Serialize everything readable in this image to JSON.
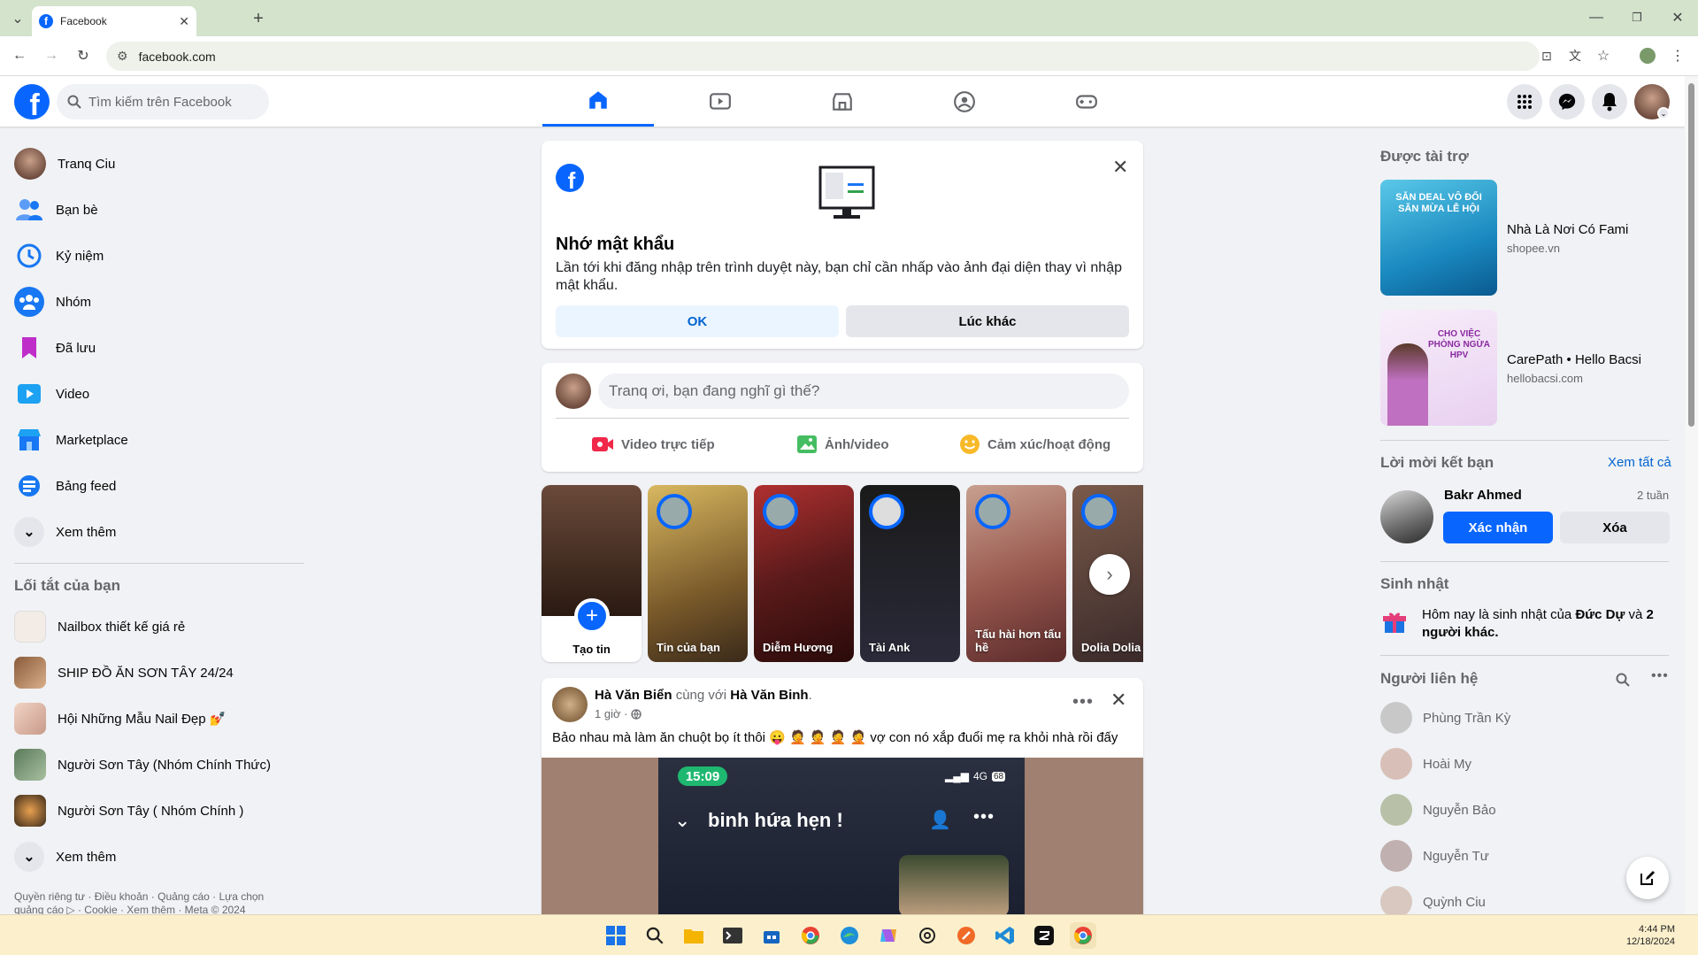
{
  "browser": {
    "tab_title": "Facebook",
    "url": "facebook.com"
  },
  "fb_nav": {
    "search_placeholder": "Tìm kiếm trên Facebook"
  },
  "left_sidebar": {
    "profile_name": "Tranq Ciu",
    "items": [
      {
        "label": "Bạn bè",
        "icon": "friends-icon"
      },
      {
        "label": "Kỷ niệm",
        "icon": "memories-icon"
      },
      {
        "label": "Nhóm",
        "icon": "groups-icon"
      },
      {
        "label": "Đã lưu",
        "icon": "saved-icon"
      },
      {
        "label": "Video",
        "icon": "video-icon"
      },
      {
        "label": "Marketplace",
        "icon": "marketplace-icon"
      },
      {
        "label": "Bảng feed",
        "icon": "feeds-icon"
      },
      {
        "label": "Xem thêm",
        "icon": "chevron-down-icon"
      }
    ],
    "shortcuts_title": "Lối tắt của bạn",
    "shortcuts": [
      {
        "label": "Nailbox thiết kế giá rẻ"
      },
      {
        "label": "SHIP ĐỒ ĂN SƠN TÂY 24/24"
      },
      {
        "label": "Hội Những Mẫu Nail Đẹp 💅"
      },
      {
        "label": "Người Sơn Tây (Nhóm Chính Thức)"
      },
      {
        "label": "Người Sơn Tây ( Nhóm Chính )"
      }
    ],
    "shortcuts_more": "Xem thêm",
    "footer_line1": "Quyền riêng tư · Điều khoản · Quảng cáo · Lựa chọn",
    "footer_line2": "quảng cáo ▷ · Cookie · Xem thêm · Meta © 2024"
  },
  "remember_password": {
    "title": "Nhớ mật khẩu",
    "body": "Lần tới khi đăng nhập trên trình duyệt này, bạn chỉ cần nhấp vào ảnh đại diện thay vì nhập mật khẩu.",
    "ok_label": "OK",
    "later_label": "Lúc khác"
  },
  "composer": {
    "placeholder": "Tranq ơi, bạn đang nghĩ gì thế?",
    "live_label": "Video trực tiếp",
    "photo_label": "Ảnh/video",
    "feeling_label": "Cảm xúc/hoạt động"
  },
  "stories": {
    "create_label": "Tạo tin",
    "items": [
      {
        "name": "Tin của bạn"
      },
      {
        "name": "Diễm Hương"
      },
      {
        "name": "Tài Ank"
      },
      {
        "name": "Tấu hài hơn tấu hề"
      },
      {
        "name": "Dolia Dolia"
      }
    ]
  },
  "post": {
    "author": "Hà Văn Biển",
    "with_text": "cùng với",
    "tagged": "Hà Văn Binh",
    "time": "1 giờ ·",
    "text": "Bảo nhau mà làm ăn chuột bọ ít thôi 😛 🤦 🤦 🤦 🤦 vợ con nó xắp đuổi mẹ ra khỏi nhà rồi đấy",
    "phone_time": "15:09",
    "phone_signal": "4G",
    "phone_battery": "68",
    "phone_title": "binh hứa hẹn !"
  },
  "right_sidebar": {
    "sponsored_title": "Được tài trợ",
    "ads": [
      {
        "title": "Nhà Là Nơi Có Fami",
        "domain": "shopee.vn",
        "image_text": "SĂN DEAL VÔ ĐỐI SĂN MỪA LỄ HỘI"
      },
      {
        "title": "CarePath • Hello Bacsi",
        "domain": "hellobacsi.com",
        "image_text": "CHO VIỆC PHÒNG NGỪA HPV"
      }
    ],
    "friend_requests_title": "Lời mời kết bạn",
    "see_all": "Xem tất cả",
    "request": {
      "name": "Bakr Ahmed",
      "time": "2 tuần",
      "confirm": "Xác nhận",
      "delete": "Xóa"
    },
    "birthday_title": "Sinh nhật",
    "birthday_pre": "Hôm nay là sinh nhật của",
    "birthday_name": "Đức Dự",
    "birthday_mid": "và",
    "birthday_others": "2 người khác.",
    "contacts_title": "Người liên hệ",
    "contacts": [
      "Phùng Trần Kỳ",
      "Hoài My",
      "Nguyễn Bảo",
      "Nguyễn Tư",
      "Quỳnh Ciu"
    ]
  },
  "taskbar": {
    "time": "4:44 PM",
    "date": "12/18/2024"
  },
  "colors": {
    "fb_blue": "#0866ff",
    "bg": "#f0f2f5",
    "chrome_tab_bar": "#d3e3cc",
    "taskbar": "#fcf0cc"
  }
}
